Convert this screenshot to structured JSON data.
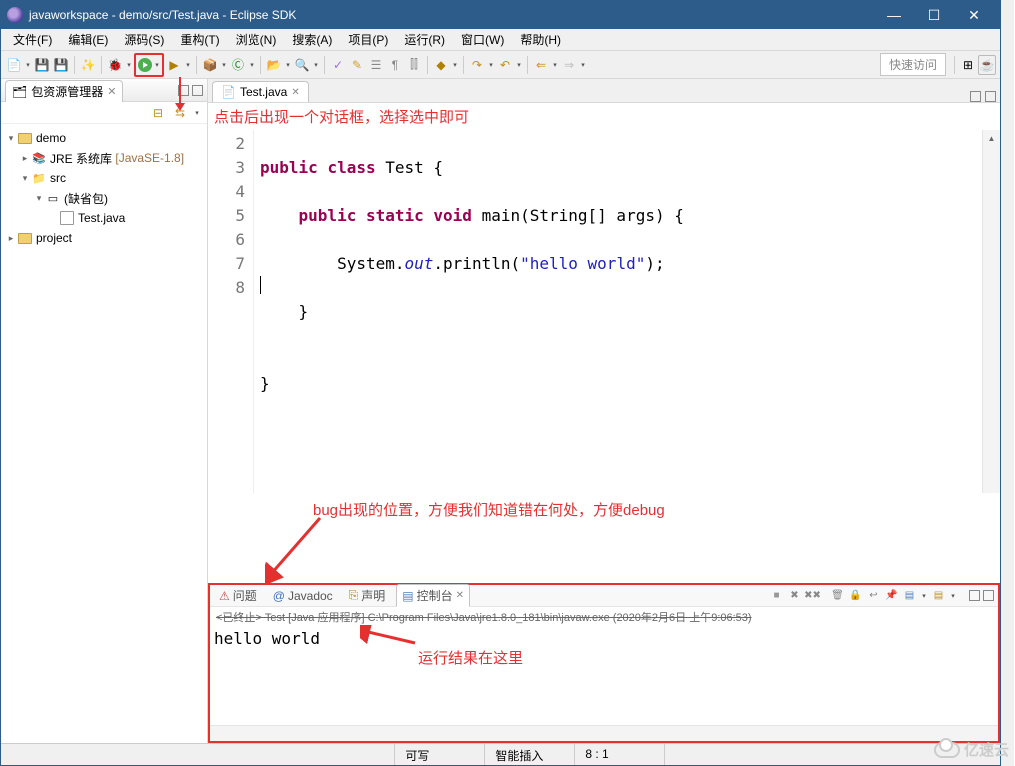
{
  "titlebar": {
    "title": "javaworkspace - demo/src/Test.java - Eclipse SDK"
  },
  "menu": {
    "file": "文件(F)",
    "edit": "编辑(E)",
    "source": "源码(S)",
    "refactor": "重构(T)",
    "navigate": "浏览(N)",
    "search": "搜索(A)",
    "project": "项目(P)",
    "run": "运行(R)",
    "window": "窗口(W)",
    "help": "帮助(H)"
  },
  "toolbar": {
    "quick_access": "快速访问"
  },
  "package_explorer": {
    "title": "包资源管理器",
    "tree": {
      "demo": "demo",
      "jre": "JRE 系统库",
      "jre_ver": "[JavaSE-1.8]",
      "src": "src",
      "default_pkg": "(缺省包)",
      "file": "Test.java",
      "project": "project"
    }
  },
  "editor": {
    "tab": "Test.java",
    "annotation_top": "点击后出现一个对话框，选择选中即可",
    "lines": [
      "2",
      "3",
      "4",
      "5",
      "6",
      "7",
      "8"
    ],
    "code": {
      "l2a": "public",
      "l2b": "class",
      "l2c": " Test {",
      "l3a": "public",
      "l3b": "static",
      "l3c": "void",
      "l3d": " main(String[] args) {",
      "l4a": "        System.",
      "l4b": "out",
      "l4c": ".println(",
      "l4d": "\"hello world\"",
      "l4e": ");",
      "l5": "    }",
      "l6": "",
      "l7": "}",
      "l8": ""
    }
  },
  "bottom": {
    "tabs": {
      "problems": "问题",
      "javadoc": "Javadoc",
      "declaration": "声明",
      "console": "控制台"
    },
    "console_meta_prefix": "<已终止> Test [Java 应用程序] C:\\Program Files\\Java\\jre1.8.0_181\\bin\\javaw.exe",
    "console_meta_date": "  (2020年2月6日 上午9:06:53)",
    "output": "hello world"
  },
  "annotations": {
    "bug": "bug出现的位置，方便我们知道错在何处，方便debug",
    "result": "运行结果在这里"
  },
  "statusbar": {
    "writable": "可写",
    "insert": "智能插入",
    "pos": "8 : 1"
  },
  "watermark": "亿速云"
}
